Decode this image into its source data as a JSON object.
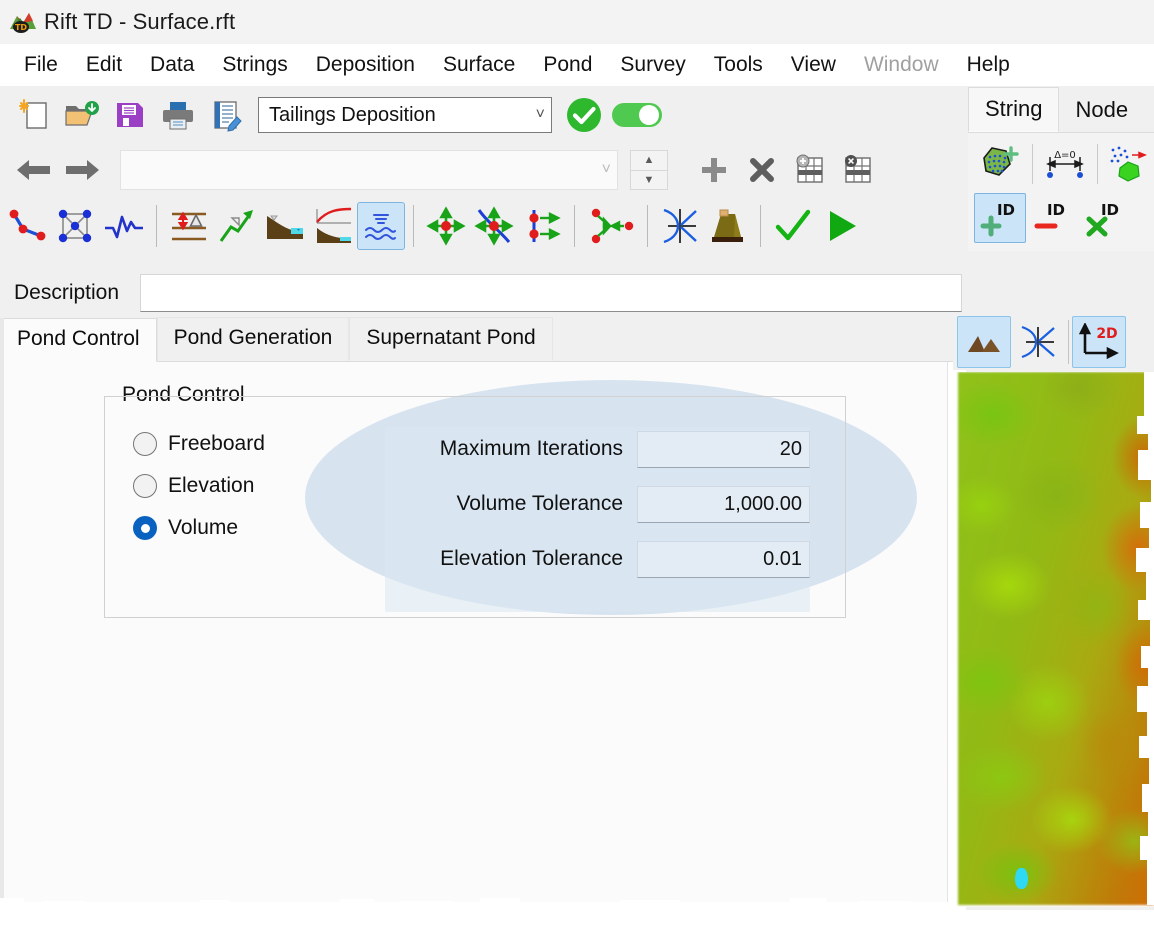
{
  "window": {
    "title": "Rift TD - Surface.rft",
    "app_icon": "app-logo-icon"
  },
  "menubar": {
    "items": [
      {
        "label": "File",
        "disabled": false
      },
      {
        "label": "Edit",
        "disabled": false
      },
      {
        "label": "Data",
        "disabled": false
      },
      {
        "label": "Strings",
        "disabled": false
      },
      {
        "label": "Deposition",
        "disabled": false
      },
      {
        "label": "Surface",
        "disabled": false
      },
      {
        "label": "Pond",
        "disabled": false
      },
      {
        "label": "Survey",
        "disabled": false
      },
      {
        "label": "Tools",
        "disabled": false
      },
      {
        "label": "View",
        "disabled": false
      },
      {
        "label": "Window",
        "disabled": true
      },
      {
        "label": "Help",
        "disabled": false
      }
    ]
  },
  "toolbar": {
    "row1": {
      "buttons": [
        {
          "icon": "new-document-icon"
        },
        {
          "icon": "open-folder-icon"
        },
        {
          "icon": "save-floppy-icon"
        },
        {
          "icon": "print-icon"
        },
        {
          "icon": "edit-report-icon"
        }
      ],
      "model_combo": {
        "value": "Tailings Deposition",
        "caret": "chevron-down-icon"
      },
      "apply_icon": "green-check-circle-icon",
      "toggle": {
        "icon": "toggle-switch-on-icon",
        "state": "on"
      }
    },
    "row2": {
      "back_icon": "arrow-left-icon",
      "forward_icon": "arrow-right-icon",
      "item_combo": {
        "value": "",
        "placeholder": "",
        "caret": "chevron-down-icon"
      },
      "spinner": {
        "up": "spinner-up-icon",
        "down": "spinner-down-icon"
      },
      "buttons": [
        {
          "icon": "plus-icon"
        },
        {
          "icon": "cross-icon"
        },
        {
          "icon": "add-row-grid-icon"
        },
        {
          "icon": "delete-row-grid-icon"
        }
      ]
    },
    "row3": {
      "buttons": [
        {
          "icon": "polyline-points-icon",
          "selected": false
        },
        {
          "icon": "mesh-nodes-icon",
          "selected": false
        },
        {
          "icon": "waveform-icon",
          "selected": false
        },
        {
          "sep": true
        },
        {
          "icon": "layer-thickness-icon",
          "selected": false
        },
        {
          "icon": "green-growth-arrow-icon",
          "selected": false
        },
        {
          "icon": "beach-profile-icon",
          "selected": false
        },
        {
          "icon": "beach-curve-icon",
          "selected": false
        },
        {
          "icon": "pond-waves-icon",
          "selected": true
        },
        {
          "sep": true
        },
        {
          "icon": "move-node-icon",
          "selected": false
        },
        {
          "icon": "move-along-curve-icon",
          "selected": false
        },
        {
          "icon": "offset-nodes-icon",
          "selected": false
        },
        {
          "sep": true
        },
        {
          "icon": "connect-nodes-icon",
          "selected": false
        },
        {
          "sep": true
        },
        {
          "icon": "intersection-axes-icon",
          "selected": false
        },
        {
          "icon": "embankment-icon",
          "selected": false
        },
        {
          "sep": true
        },
        {
          "icon": "green-check-icon",
          "selected": false
        },
        {
          "icon": "green-play-icon",
          "selected": false
        }
      ]
    }
  },
  "description": {
    "label": "Description",
    "value": "",
    "placeholder": ""
  },
  "tabs": [
    {
      "label": "Pond Control",
      "active": true
    },
    {
      "label": "Pond Generation",
      "active": false
    },
    {
      "label": "Supernatant Pond",
      "active": false
    }
  ],
  "pond_control": {
    "group_title": "Pond Control",
    "radios": [
      {
        "label": "Freeboard",
        "selected": false
      },
      {
        "label": "Elevation",
        "selected": false
      },
      {
        "label": "Volume",
        "selected": true
      }
    ],
    "fields": [
      {
        "label": "Maximum Iterations",
        "value": "20"
      },
      {
        "label": "Volume Tolerance",
        "value": "1,000.00"
      },
      {
        "label": "Elevation Tolerance",
        "value": "0.01"
      }
    ]
  },
  "right_dock": {
    "tabs": [
      {
        "label": "String",
        "active": true
      },
      {
        "label": "Node",
        "active": false
      }
    ],
    "tools_row1": [
      {
        "icon": "add-polygon-region-icon",
        "selected": false
      },
      {
        "sep": true
      },
      {
        "icon": "delta-zero-spacing-icon",
        "selected": false
      },
      {
        "sep": true
      },
      {
        "icon": "scatter-to-polygon-icon",
        "selected": false
      }
    ],
    "tools_row2": [
      {
        "icon": "id-add-icon",
        "label": "ID",
        "selected": true
      },
      {
        "icon": "id-remove-icon",
        "label": "ID",
        "selected": false
      },
      {
        "icon": "id-delete-icon",
        "label": "ID",
        "selected": false
      }
    ]
  },
  "view_toolbar": {
    "buttons": [
      {
        "icon": "terrain-surface-icon",
        "selected": true
      },
      {
        "icon": "axes-lines-icon",
        "selected": false
      },
      {
        "sep": true
      },
      {
        "icon": "2d-axis-icon",
        "label": "2D",
        "selected": true
      }
    ]
  },
  "viewport": {
    "name": "terrain-elevation-map",
    "pond_name": "supernatant-pond-shape"
  },
  "colors": {
    "accent_blue": "#0a62c0",
    "selection_blue": "#cce4f7",
    "highlight_ellipse": "#d7e4f0",
    "green": "#2eb82e",
    "terrain_low": "#8fc21a",
    "terrain_high": "#cf6c05",
    "pond_cyan": "#2fd8f3"
  }
}
